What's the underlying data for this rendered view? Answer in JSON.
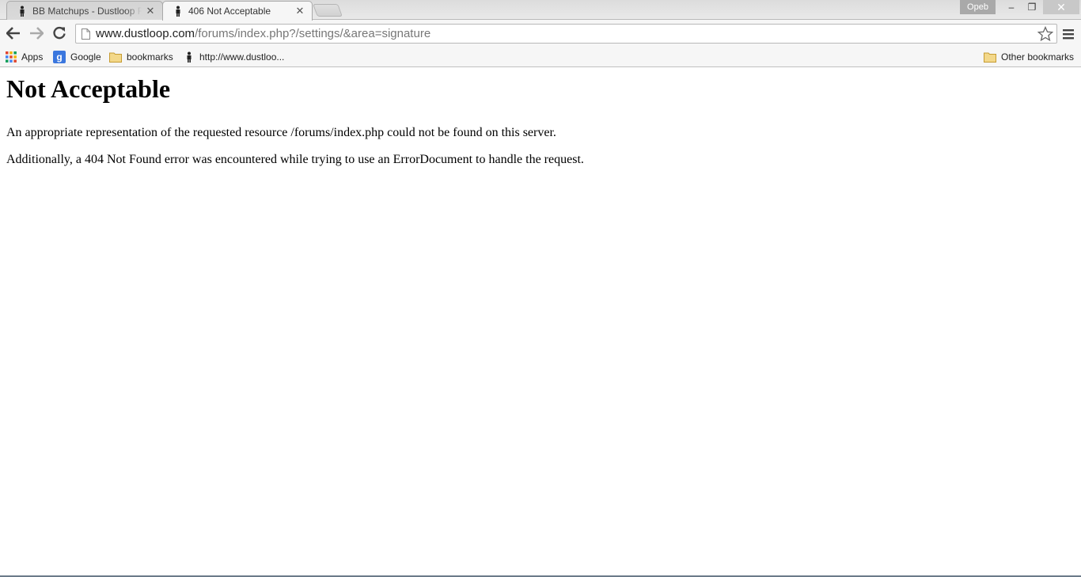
{
  "browser": {
    "tabs": [
      {
        "title": "BB Matchups - Dustloop F",
        "active": false
      },
      {
        "title": "406 Not Acceptable",
        "active": true
      }
    ],
    "profile_name": "Opeb",
    "window_controls": {
      "minimize": "–",
      "maximize": "❐",
      "close": "✕"
    },
    "address": {
      "host": "www.dustloop.com",
      "path": "/forums/index.php?/settings/&area=signature"
    },
    "bookmarks": [
      {
        "label": "Apps",
        "icon": "apps-grid-icon"
      },
      {
        "label": "Google",
        "icon": "google-icon"
      },
      {
        "label": "bookmarks",
        "icon": "folder-icon"
      },
      {
        "label": "http://www.dustloo...",
        "icon": "dustloop-favicon"
      }
    ],
    "other_bookmarks": "Other bookmarks"
  },
  "page": {
    "heading": "Not Acceptable",
    "paragraphs": [
      "An appropriate representation of the requested resource /forums/index.php could not be found on this server.",
      "Additionally, a 404 Not Found error was encountered while trying to use an ErrorDocument to handle the request."
    ]
  },
  "colors": {
    "apps_grid": [
      "#e0452f",
      "#f4b400",
      "#0f9d58",
      "#4285f4"
    ],
    "google_icon": "#3b77de",
    "folder": "#e9c35a"
  }
}
